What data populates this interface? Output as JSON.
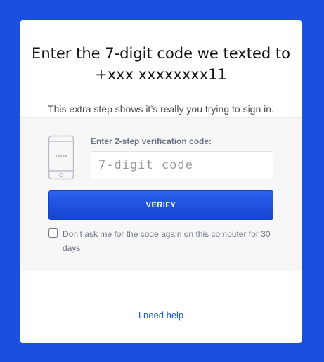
{
  "card": {
    "title": "Enter the 7-digit code we texted to +xxx xxxxxxxx11",
    "subtitle": "This extra step shows it’s really you trying to sign in."
  },
  "form": {
    "code_label": "Enter 2-step verification code:",
    "code_placeholder": "7-digit code",
    "code_value": "",
    "verify_label": "VERIFY",
    "remember_label": "Don’t ask me for the code again on this computer for 30 days",
    "remember_checked": false
  },
  "footer": {
    "help_link": "I need help"
  },
  "icons": {
    "phone": "phone-icon"
  },
  "colors": {
    "background": "#1a4fe0",
    "button": "#1a4fe0",
    "link": "#1a5bd6"
  }
}
